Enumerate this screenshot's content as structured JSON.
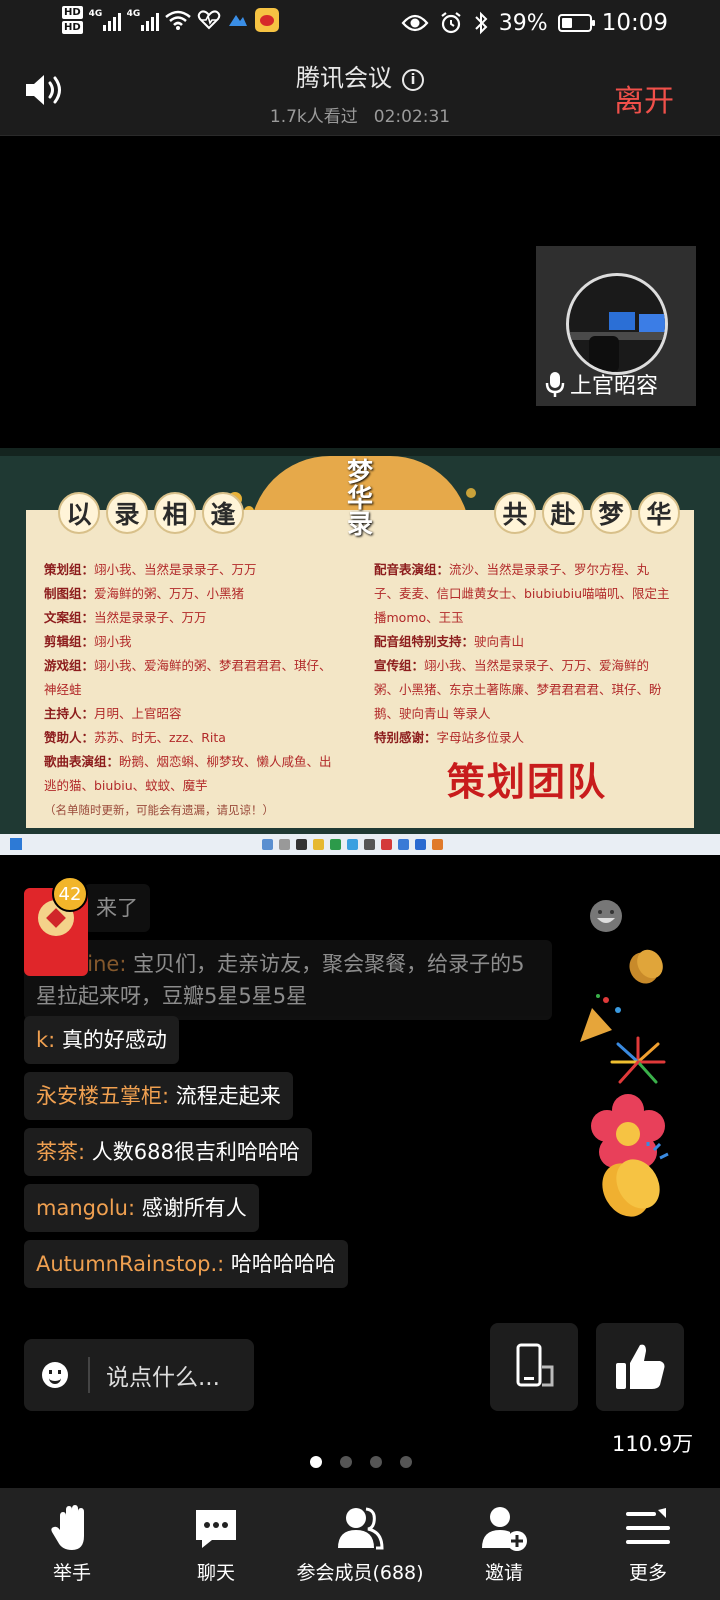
{
  "status_bar": {
    "hd1": "HD",
    "hd2": "HD",
    "net1": "4G",
    "net2": "4G",
    "battery": "39%",
    "battery_level": 0.39,
    "time": "10:09"
  },
  "header": {
    "title": "腾讯会议",
    "viewers": "1.7k人看过",
    "elapsed": "02:02:31",
    "leave_label": "离开"
  },
  "participant_tile": {
    "name": "上官昭容"
  },
  "shared_screen": {
    "calligraphy": "梦华录",
    "banner_left": [
      "以",
      "录",
      "相",
      "逢"
    ],
    "banner_right": [
      "共",
      "赴",
      "梦",
      "华"
    ],
    "left_column": [
      {
        "role": "策划组：",
        "names": "翊小我、当然是录录子、万万"
      },
      {
        "role": "制图组：",
        "names": "爱海鲜的粥、万万、小黑猪"
      },
      {
        "role": "文案组：",
        "names": "当然是录录子、万万"
      },
      {
        "role": "剪辑组：",
        "names": "翊小我"
      },
      {
        "role": "游戏组：",
        "names": "翊小我、爱海鲜的粥、梦君君君君、琪仔、神经蛙"
      },
      {
        "role": "主持人：",
        "names": "月明、上官昭容"
      },
      {
        "role": "赞助人：",
        "names": "苏苏、时无、zzz、Rita"
      },
      {
        "role": "歌曲表演组：",
        "names": "盼鹅、烟恋蝌、柳梦玫、懒人咸鱼、出逃的猫、biubiu、蚊蚊、魔芋"
      }
    ],
    "note": "（名单随时更新，可能会有遗漏，请见谅！）",
    "right_column": [
      {
        "role": "配音表演组：",
        "names": "流沙、当然是录录子、罗尔方程、丸子、麦麦、信口雌黄女士、biubiubiu喵喵叽、限定主播momo、王玉"
      },
      {
        "role": "配音组特别支持：",
        "names": "驶向青山"
      },
      {
        "role": "宣传组：",
        "names": "翊小我、当然是录录子、万万、爱海鲜的粥、小黑猪、东京土著陈廉、梦君君君君、琪仔、盼鹅、驶向青山 等录人"
      },
      {
        "role": "特别感谢：",
        "names": "字母站多位录人"
      }
    ],
    "team_title": "策划团队"
  },
  "chat": {
    "red_packet_count": "42",
    "messages": [
      {
        "user": "",
        "text": "来了",
        "partial": true
      },
      {
        "user": "caroline:",
        "text": "宝贝们，走亲访友，聚会聚餐，给录子的5星拉起来呀，豆瓣5星5星5星",
        "partial": true
      },
      {
        "user": "k:",
        "text": "真的好感动"
      },
      {
        "user": "永安楼五掌柜:",
        "text": "流程走起来"
      },
      {
        "user": "茶茶:",
        "text": "人数688很吉利哈哈哈"
      },
      {
        "user": "mangolu:",
        "text": "感谢所有人"
      },
      {
        "user": "AutumnRainstop.:",
        "text": "哈哈哈哈哈"
      }
    ],
    "input_placeholder": "说点什么...",
    "like_count": "110.9万"
  },
  "pager": {
    "pages": 4,
    "current": 1
  },
  "bottom_nav": [
    {
      "label": "举手",
      "icon": "raise-hand-icon"
    },
    {
      "label": "聊天",
      "icon": "chat-bubble-icon"
    },
    {
      "label": "参会成员(688)",
      "icon": "members-icon"
    },
    {
      "label": "邀请",
      "icon": "invite-icon"
    },
    {
      "label": "更多",
      "icon": "more-menu-icon"
    }
  ],
  "colors": {
    "leave": "#f0504a",
    "username": "#f0a050",
    "badge": "#f2b52a",
    "red_packet": "#e0262a",
    "team_title": "#c81c1c"
  }
}
